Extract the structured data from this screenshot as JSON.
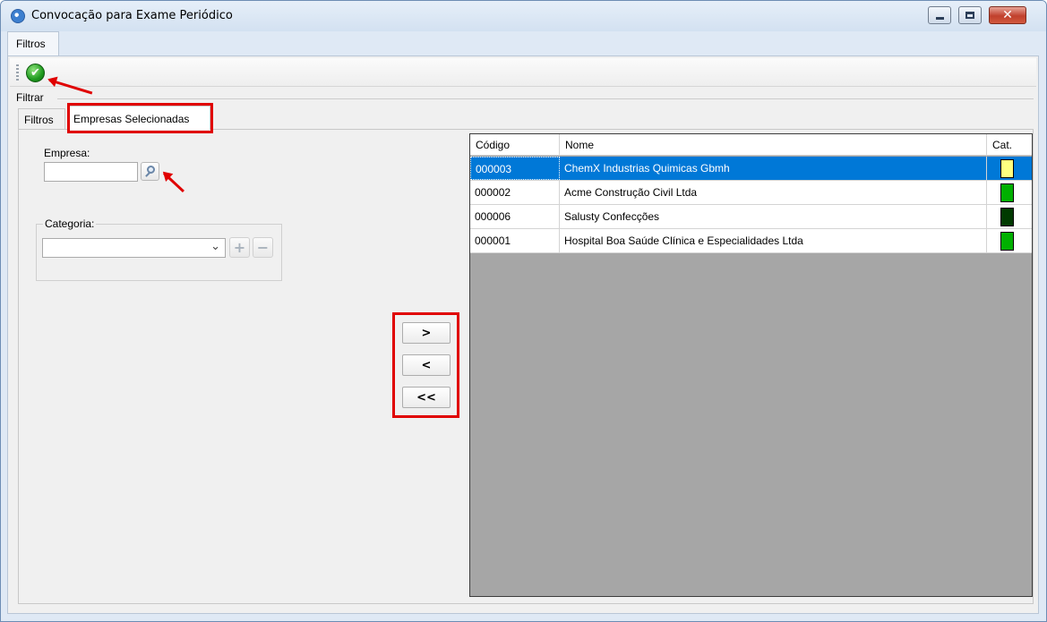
{
  "window": {
    "title": "Convocação para Exame Periódico"
  },
  "menu": {
    "tab_label": "Filtros"
  },
  "group": {
    "label": "Filtrar"
  },
  "tabs": [
    {
      "label": "Filtros"
    },
    {
      "label": "Empresas Selecionadas"
    }
  ],
  "form": {
    "empresa_label": "Empresa:",
    "empresa_value": "",
    "categoria_label": "Categoria:",
    "categoria_value": ""
  },
  "move_buttons": {
    "add": ">",
    "remove": "<",
    "remove_all": "<<"
  },
  "grid": {
    "headers": {
      "code": "Código",
      "name": "Nome",
      "cat": "Cat."
    },
    "rows": [
      {
        "code": "000003",
        "name": "ChemX Industrias Quimicas Gbmh",
        "cat_color": "#ffff80",
        "selected": true
      },
      {
        "code": "000002",
        "name": "Acme Construção Civil Ltda",
        "cat_color": "#00b000",
        "selected": false
      },
      {
        "code": "000006",
        "name": "Salusty Confecções",
        "cat_color": "#003a00",
        "selected": false
      },
      {
        "code": "000001",
        "name": "Hospital Boa Saúde Clínica e Especialidades Ltda",
        "cat_color": "#00b000",
        "selected": false
      }
    ]
  },
  "colors": {
    "selection": "#0078d7",
    "highlight": "#e00000",
    "grid_empty": "#a6a6a6"
  }
}
